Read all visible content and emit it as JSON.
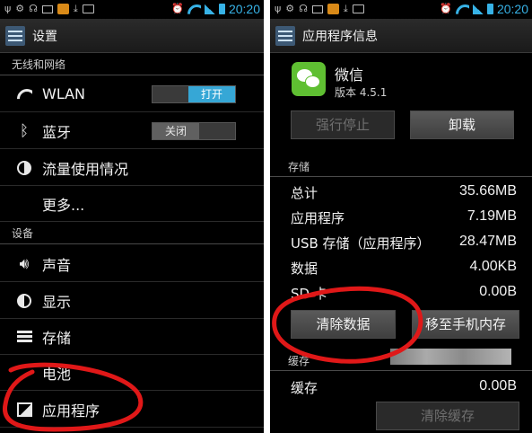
{
  "left": {
    "status_time": "20:20",
    "title": "设置",
    "sections": [
      {
        "header": "无线和网络"
      },
      {
        "header": "设备"
      }
    ],
    "wlan": {
      "label": "WLAN",
      "toggle": "打开"
    },
    "bluetooth": {
      "label": "蓝牙",
      "toggle": "关闭"
    },
    "data_usage": {
      "label": "流量使用情况"
    },
    "more": {
      "label": "更多..."
    },
    "sound": {
      "label": "声音"
    },
    "display": {
      "label": "显示"
    },
    "storage": {
      "label": "存储"
    },
    "battery": {
      "label": "电池"
    },
    "apps": {
      "label": "应用程序"
    }
  },
  "right": {
    "status_time": "20:20",
    "title": "应用程序信息",
    "app_name": "微信",
    "app_version": "版本 4.5.1",
    "force_stop": "强行停止",
    "uninstall": "卸载",
    "storage_header": "存储",
    "stats": [
      {
        "key": "总计",
        "value": "35.66MB"
      },
      {
        "key": "应用程序",
        "value": "7.19MB"
      },
      {
        "key": "USB 存储（应用程序）",
        "value": "28.47MB"
      },
      {
        "key": "数据",
        "value": "4.00KB"
      },
      {
        "key": "SD 卡",
        "value": "0.00B"
      }
    ],
    "clear_data": "清除数据",
    "move_to_phone": "移至手机内存",
    "cache_header": "缓存",
    "cache": {
      "key": "缓存",
      "value": "0.00B"
    },
    "clear_cache": "清除缓存"
  },
  "colors": {
    "accent": "#37b2e6",
    "annotation": "#e01818",
    "wechat": "#5fbf32"
  },
  "icons": [
    "usb-icon",
    "mail-icon",
    "download-icon",
    "alarm-icon",
    "wifi-icon",
    "signal-icon",
    "battery-icon",
    "settings-icon",
    "bluetooth-icon",
    "data-usage-icon",
    "sound-icon",
    "display-icon",
    "storage-icon",
    "apps-icon",
    "wechat-icon"
  ]
}
